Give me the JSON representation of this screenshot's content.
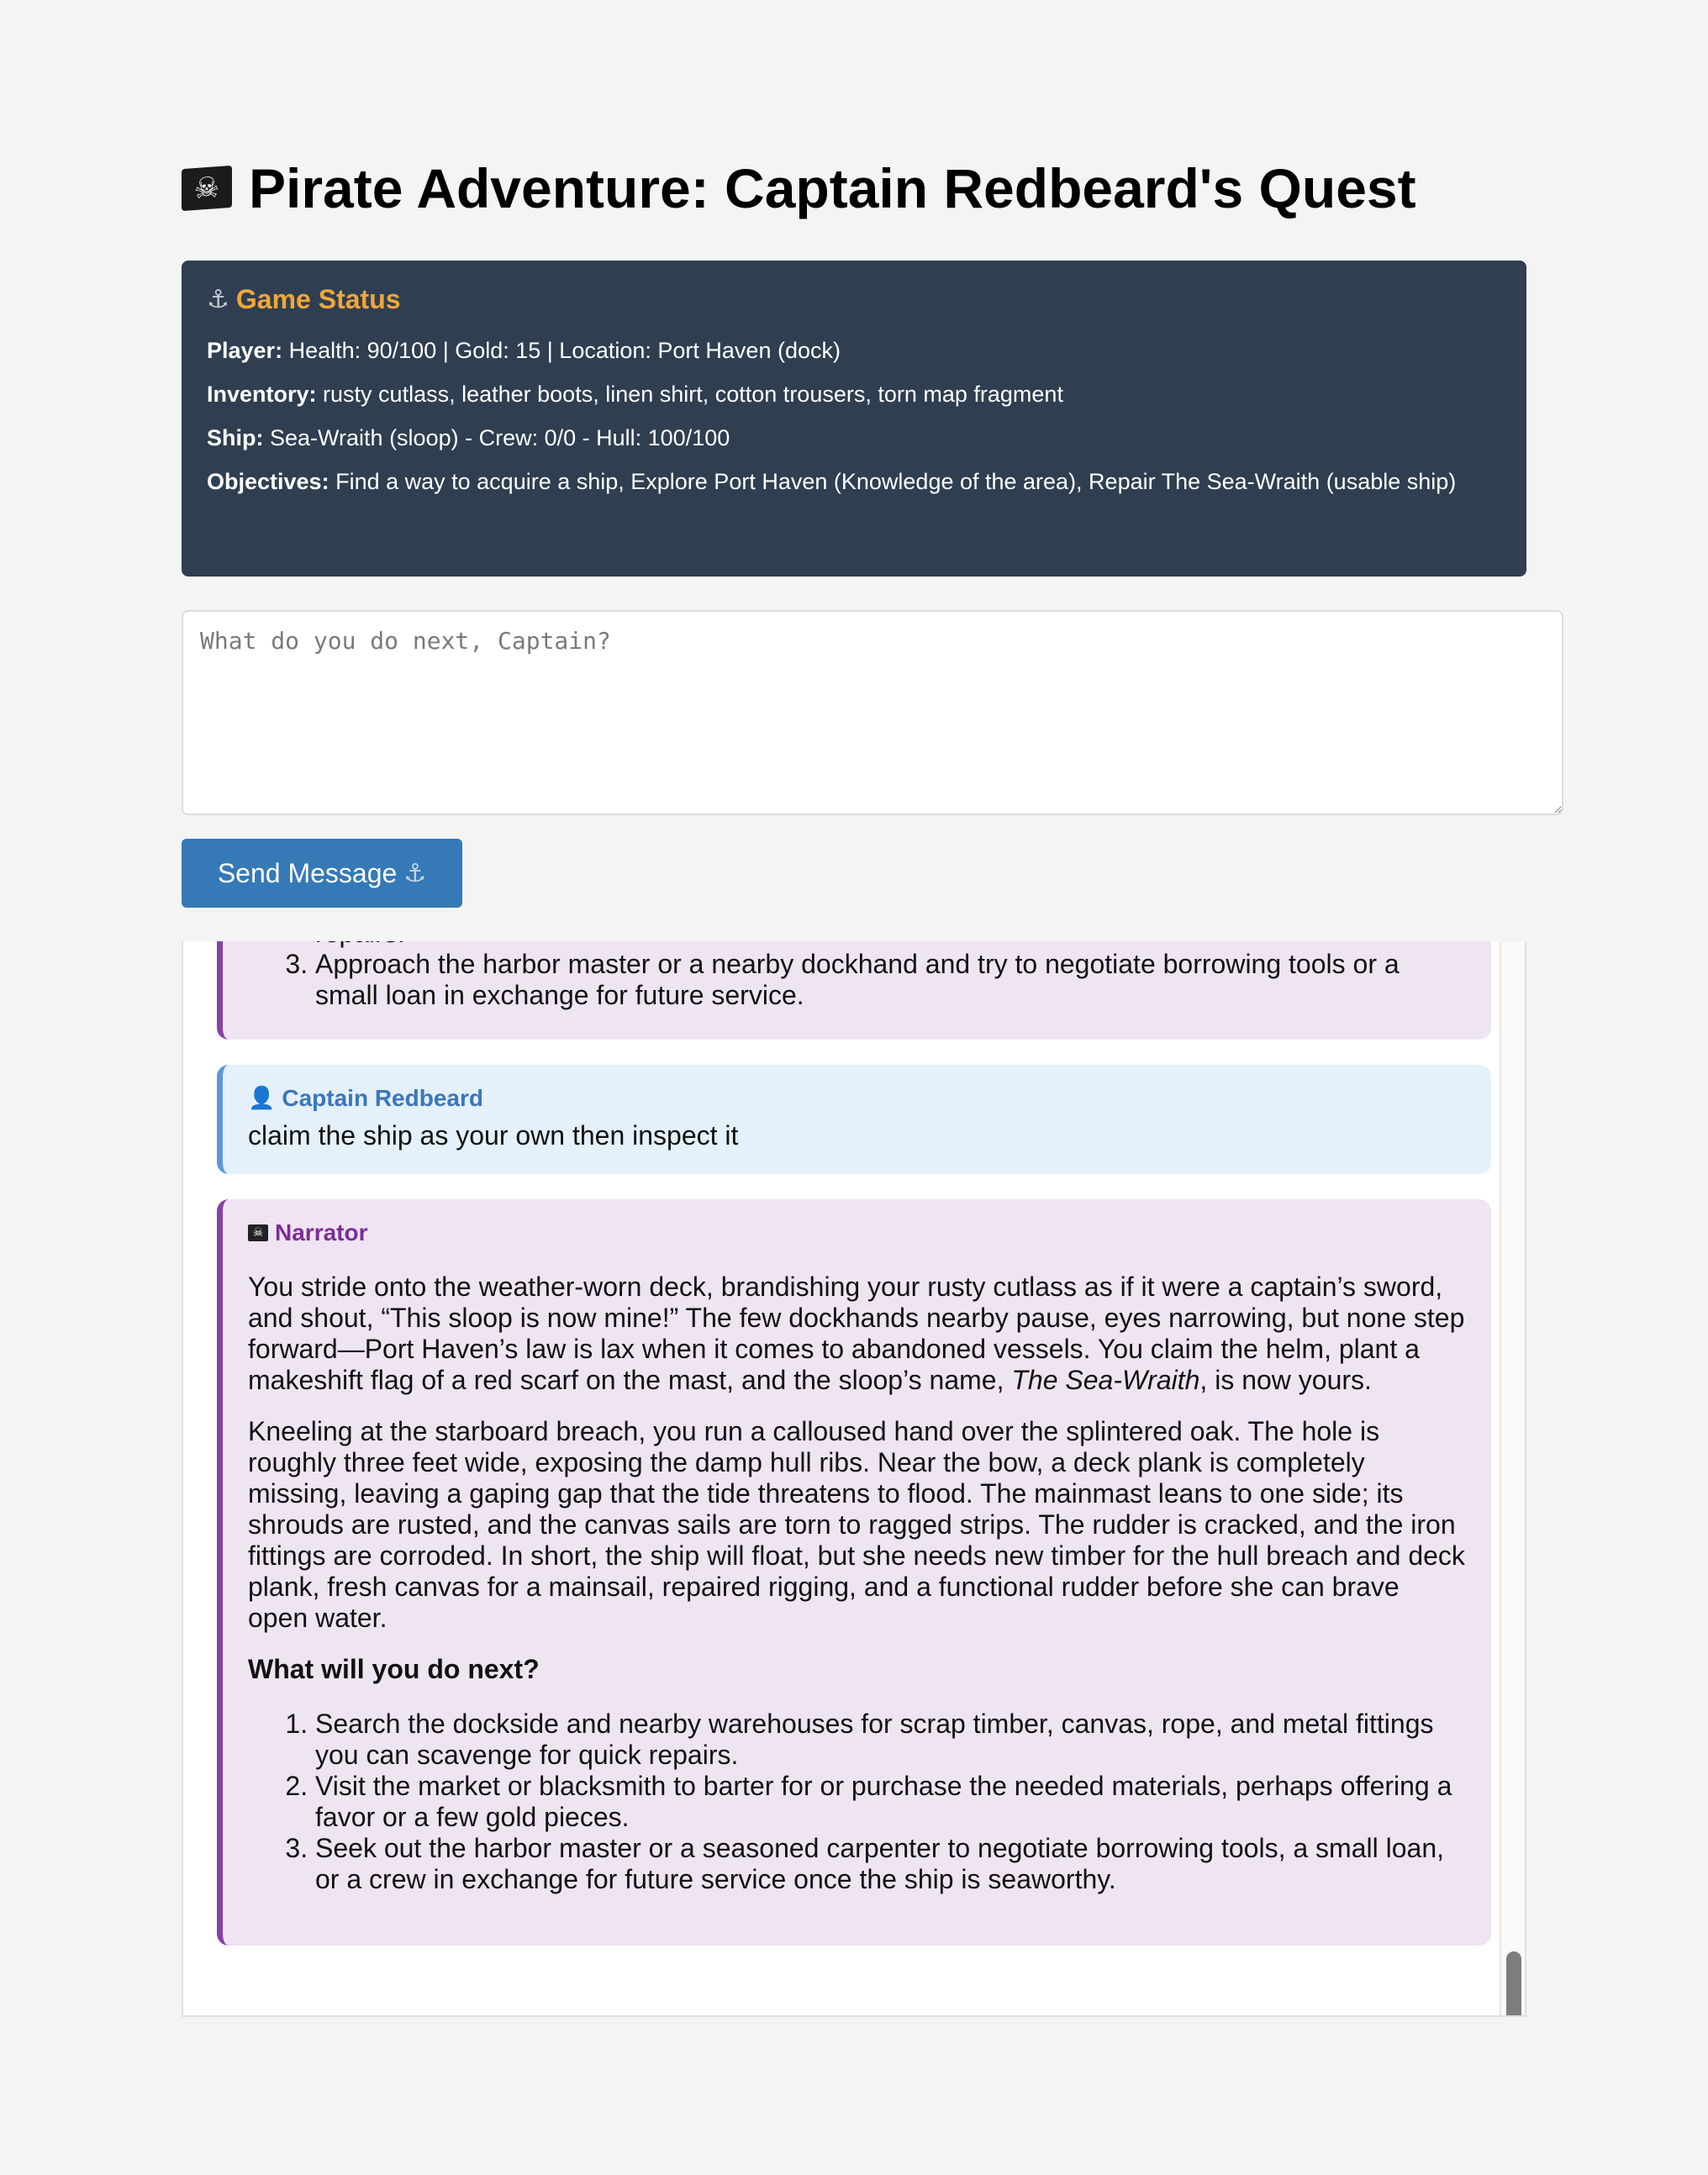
{
  "header": {
    "title": "Pirate Adventure: Captain Redbeard's Quest",
    "icon": "pirate-flag-icon"
  },
  "status": {
    "title": "Game Status",
    "player_label": "Player:",
    "player_value": "Health: 90/100 | Gold: 15 | Location: Port Haven (dock)",
    "inventory_label": "Inventory:",
    "inventory_value": "rusty cutlass, leather boots, linen shirt, cotton trousers, torn map fragment",
    "ship_label": "Ship:",
    "ship_value": "Sea-Wraith (sloop) - Crew: 0/0 - Hull: 100/100",
    "objectives_label": "Objectives:",
    "objectives_value": "Find a way to acquire a ship, Explore Port Haven (Knowledge of the area), Repair The Sea-Wraith (usable ship)",
    "accent_color": "#f0a63a",
    "panel_color": "#2f3e50"
  },
  "input": {
    "placeholder": "What do you do next, Captain?",
    "value": ""
  },
  "send_button": {
    "label": "Send Message"
  },
  "log": {
    "prev_narrator": {
      "cut_line": "repairs.",
      "item3": "Approach the harbor master or a nearby dockhand and try to negotiate borrowing tools or a small loan in exchange for future service."
    },
    "player_msg": {
      "name": "Captain Redbeard",
      "text": "claim the ship as your own then inspect it"
    },
    "narrator_msg": {
      "name": "Narrator",
      "p1_a": "You stride onto the weather-worn deck, brandishing your rusty cutlass as if it were a captain’s sword, and shout, “This sloop is now mine!” The few dockhands nearby pause, eyes narrowing, but none step forward—Port Haven’s law is lax when it comes to abandoned vessels. You claim the helm, plant a makeshift flag of a red scarf on the mast, and the sloop’s name, ",
      "p1_ship": "The Sea-Wraith",
      "p1_b": ", is now yours.",
      "p2": "Kneeling at the starboard breach, you run a calloused hand over the splintered oak. The hole is roughly three feet wide, exposing the damp hull ribs. Near the bow, a deck plank is completely missing, leaving a gaping gap that the tide threatens to flood. The mainmast leans to one side; its shrouds are rusted, and the canvas sails are torn to ragged strips. The rudder is cracked, and the iron fittings are corroded. In short, the ship will float, but she needs new timber for the hull breach and deck plank, fresh canvas for a mainsail, repaired rigging, and a functional rudder before she can brave open water.",
      "question": "What will you do next?",
      "options": [
        "Search the dockside and nearby warehouses for scrap timber, canvas, rope, and metal fittings you can scavenge for quick repairs.",
        "Visit the market or blacksmith to barter for or purchase the needed materials, perhaps offering a favor or a few gold pieces.",
        "Seek out the harbor master or a seasoned carpenter to negotiate borrowing tools, a small loan, or a crew in exchange for future service once the ship is seaworthy."
      ]
    }
  }
}
